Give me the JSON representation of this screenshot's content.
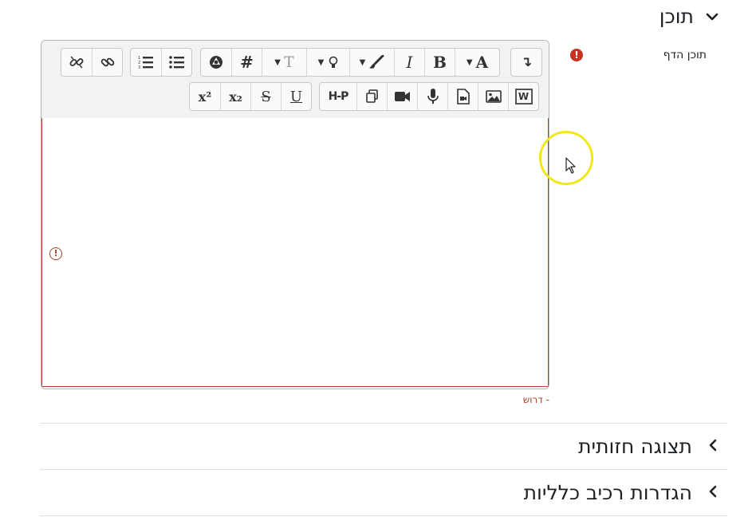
{
  "sections": {
    "content": {
      "title": "תוכן",
      "chevron": "chevron-down-icon"
    },
    "appearance": {
      "title": "תצוגה חזותית",
      "chevron": "chevron-left-icon"
    },
    "common": {
      "title": "הגדרות רכיב כלליות",
      "chevron": "chevron-left-icon"
    }
  },
  "field": {
    "label": "תוכן הדף",
    "required_marker": "!",
    "required_text": "- דרוש"
  },
  "editor": {
    "toolbar_row1": [
      {
        "name": "collapse",
        "label": "↴"
      },
      {
        "name": "font-color",
        "label": "A"
      },
      {
        "name": "bold",
        "label": "B"
      },
      {
        "name": "italic",
        "label": "I"
      },
      {
        "name": "background-color",
        "label": ""
      },
      {
        "name": "styles",
        "label": ""
      },
      {
        "name": "font-size",
        "label": "T"
      },
      {
        "name": "insert-char",
        "label": "#"
      },
      {
        "name": "accessibility",
        "label": ""
      },
      {
        "name": "unordered-list",
        "label": ""
      },
      {
        "name": "ordered-list",
        "label": ""
      },
      {
        "name": "link",
        "label": ""
      },
      {
        "name": "unlink",
        "label": ""
      }
    ],
    "toolbar_row2": [
      {
        "name": "word-paste",
        "label": "W"
      },
      {
        "name": "image",
        "label": ""
      },
      {
        "name": "media",
        "label": ""
      },
      {
        "name": "record-audio",
        "label": ""
      },
      {
        "name": "record-video",
        "label": ""
      },
      {
        "name": "manage-files",
        "label": ""
      },
      {
        "name": "h5p",
        "label": "H-P"
      },
      {
        "name": "underline",
        "label": "U"
      },
      {
        "name": "strikethrough",
        "label": "S"
      },
      {
        "name": "subscript",
        "label": "x₂"
      },
      {
        "name": "superscript",
        "label": "x²"
      }
    ],
    "error_marker": "!"
  },
  "colors": {
    "required": "#ca3120",
    "error": "#a9432c",
    "cursor_highlight": "#f0e81a"
  }
}
